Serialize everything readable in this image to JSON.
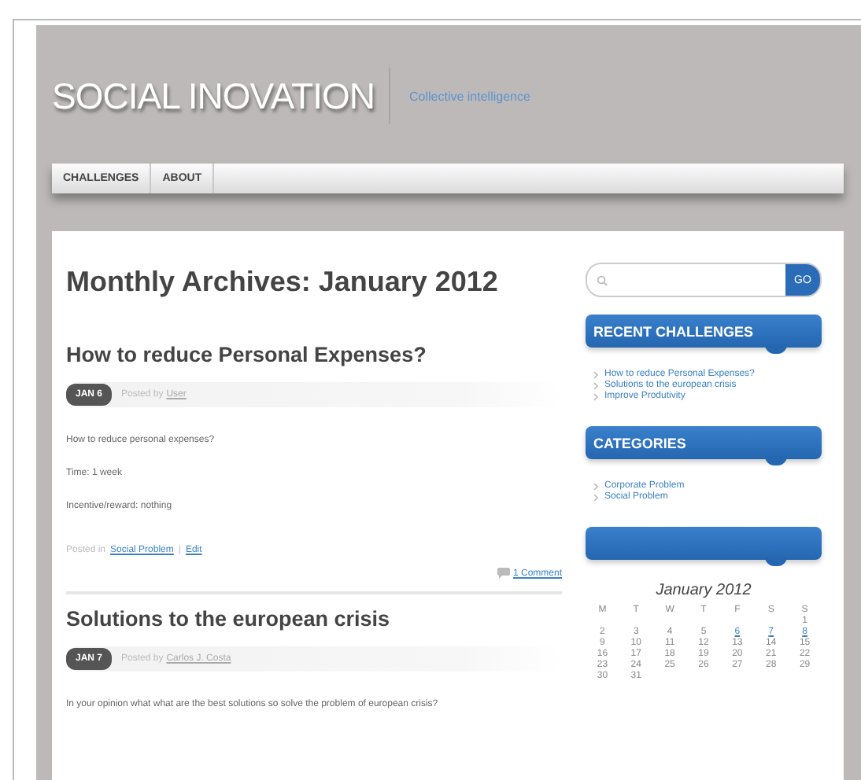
{
  "header": {
    "site_title": "SOCIAL INOVATION",
    "tagline": "Collective intelligence"
  },
  "nav": [
    {
      "label": "CHALLENGES"
    },
    {
      "label": "ABOUT"
    }
  ],
  "page_title": "Monthly Archives: January 2012",
  "posts": [
    {
      "title": "How to reduce Personal Expenses?",
      "date": "JAN 6",
      "posted_by": "Posted by",
      "author": "User",
      "body": [
        "How to reduce personal expenses?",
        "Time: 1 week",
        "Incentive/reward: nothing"
      ],
      "posted_in": "Posted in",
      "category": "Social Problem",
      "separator": "|",
      "edit": "Edit",
      "comments": "1 Comment"
    },
    {
      "title": "Solutions to the european crisis",
      "date": "JAN 7",
      "posted_by": "Posted by",
      "author": "Carlos J. Costa",
      "body": [
        "In your opinion what what are the best solutions so solve the problem of european crisis?"
      ]
    }
  ],
  "sidebar": {
    "search": {
      "button": "GO"
    },
    "widgets": [
      {
        "kind": "list",
        "title": "RECENT CHALLENGES",
        "items": [
          "How to reduce Personal Expenses?",
          "Solutions to the european crisis",
          "Improve Produtivity"
        ]
      },
      {
        "kind": "list",
        "title": "CATEGORIES",
        "items": [
          "Corporate Problem",
          "Social Problem"
        ]
      },
      {
        "kind": "calendar",
        "calendar": {
          "caption": "January 2012",
          "weekdays": [
            "M",
            "T",
            "W",
            "T",
            "F",
            "S",
            "S"
          ],
          "weeks": [
            [
              {
                "day": "1",
                "linked": false
              }
            ],
            [
              {
                "day": "2",
                "linked": false
              },
              {
                "day": "3",
                "linked": false
              },
              {
                "day": "4",
                "linked": false
              },
              {
                "day": "5",
                "linked": false
              },
              {
                "day": "6",
                "linked": true
              },
              {
                "day": "7",
                "linked": true
              },
              {
                "day": "8",
                "linked": true
              }
            ],
            [
              {
                "day": "9",
                "linked": false
              },
              {
                "day": "10",
                "linked": false
              },
              {
                "day": "11",
                "linked": false
              },
              {
                "day": "12",
                "linked": false
              },
              {
                "day": "13",
                "linked": false
              },
              {
                "day": "14",
                "linked": false
              },
              {
                "day": "15",
                "linked": false
              }
            ],
            [
              {
                "day": "16",
                "linked": false
              },
              {
                "day": "17",
                "linked": false
              },
              {
                "day": "18",
                "linked": false
              },
              {
                "day": "19",
                "linked": false
              },
              {
                "day": "20",
                "linked": false
              },
              {
                "day": "21",
                "linked": false
              },
              {
                "day": "22",
                "linked": false
              }
            ],
            [
              {
                "day": "23",
                "linked": false
              },
              {
                "day": "24",
                "linked": false
              },
              {
                "day": "25",
                "linked": false
              },
              {
                "day": "26",
                "linked": false
              },
              {
                "day": "27",
                "linked": false
              },
              {
                "day": "28",
                "linked": false
              },
              {
                "day": "29",
                "linked": false
              }
            ],
            [
              {
                "day": "30",
                "linked": false
              },
              {
                "day": "31",
                "linked": false
              }
            ]
          ]
        }
      }
    ]
  }
}
